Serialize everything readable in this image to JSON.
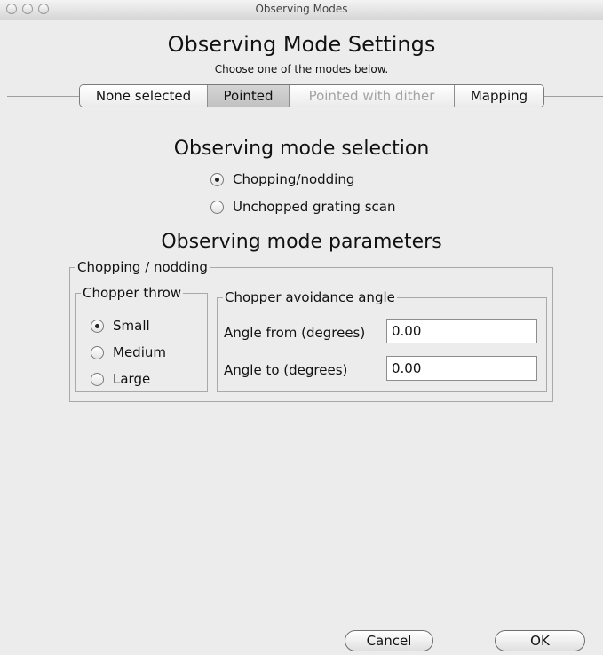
{
  "window": {
    "title": "Observing Modes"
  },
  "header": {
    "title": "Observing Mode Settings",
    "subtitle": "Choose one of the modes below."
  },
  "segments": [
    {
      "label": "None selected",
      "selected": false,
      "enabled": true
    },
    {
      "label": "Pointed",
      "selected": true,
      "enabled": true
    },
    {
      "label": "Pointed with dither",
      "selected": false,
      "enabled": false
    },
    {
      "label": "Mapping",
      "selected": false,
      "enabled": true
    }
  ],
  "mode_selection": {
    "heading": "Observing mode selection",
    "options": [
      {
        "label": "Chopping/nodding",
        "selected": true
      },
      {
        "label": "Unchopped grating scan",
        "selected": false
      }
    ]
  },
  "parameters": {
    "heading": "Observing mode parameters",
    "group_label": "Chopping / nodding",
    "chopper_throw": {
      "label": "Chopper throw",
      "options": [
        {
          "label": "Small",
          "selected": true
        },
        {
          "label": "Medium",
          "selected": false
        },
        {
          "label": "Large",
          "selected": false
        }
      ]
    },
    "avoidance": {
      "label": "Chopper avoidance angle",
      "angle_from_label": "Angle from (degrees)",
      "angle_from_value": "0.00",
      "angle_to_label": "Angle to (degrees)",
      "angle_to_value": "0.00"
    }
  },
  "footer": {
    "cancel_label": "Cancel",
    "ok_label": "OK"
  }
}
